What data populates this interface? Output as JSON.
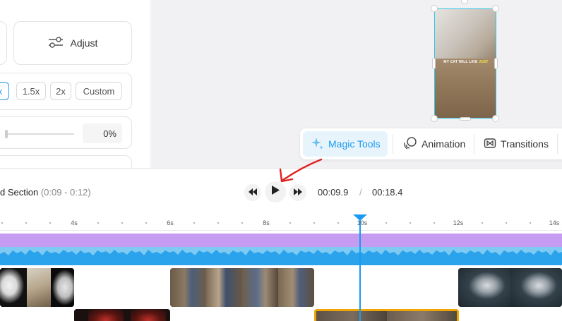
{
  "panel": {
    "adjust_label": "Adjust",
    "speed_options": [
      "x",
      "1.5x",
      "2x",
      "Custom"
    ],
    "slider_value": "0%"
  },
  "tools": {
    "magic": "Magic Tools",
    "animation": "Animation",
    "transitions": "Transitions"
  },
  "preview": {
    "caption_main": "MY CAT WILL LI",
    "caption_mid": "KE",
    "caption_hl": "JUST"
  },
  "timeline": {
    "section_name": "d Section",
    "section_range": "(0:09 - 0:12)",
    "current_time": "00:09.9",
    "separator": "/",
    "total_time": "00:18.4",
    "ruler_labels": [
      "4s",
      "6s",
      "8s",
      "10s",
      "12s",
      "14s"
    ]
  },
  "colors": {
    "accent": "#1a9bf0",
    "purple_track": "#c69cf3",
    "audio_track": "#7fcaf3",
    "selected_clip": "#f0a500",
    "annotation_arrow": "#e02020"
  }
}
